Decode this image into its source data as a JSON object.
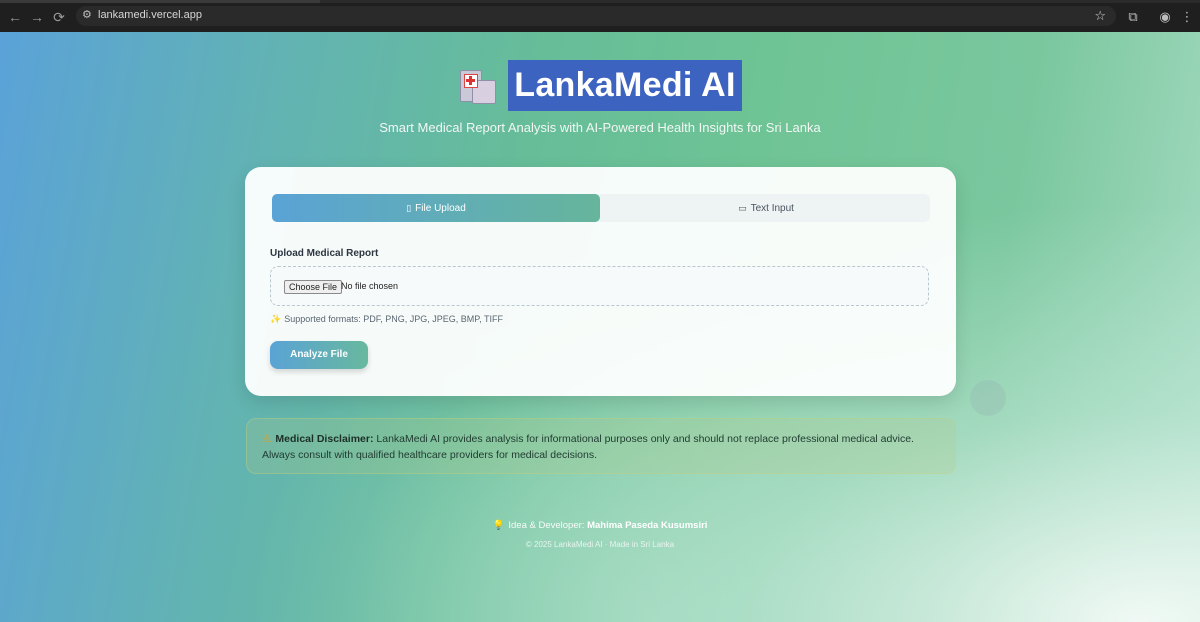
{
  "browser": {
    "url": "lankamedi.vercel.app",
    "back_icon": "←",
    "forward_icon": "→",
    "reload_icon": "⟳",
    "star_icon": "☆"
  },
  "header": {
    "title": "LankaMedi AI",
    "subtitle": "Smart Medical Report Analysis with AI-Powered Health Insights for Sri Lanka"
  },
  "tabs": [
    {
      "icon": "▯",
      "label": "File Upload",
      "active": true
    },
    {
      "icon": "▭",
      "label": "Text Input",
      "active": false
    }
  ],
  "upload": {
    "label": "Upload Medical Report",
    "choose_button": "Choose File",
    "status": "No file chosen",
    "formats": "Supported formats: PDF, PNG, JPG, JPEG, BMP, TIFF",
    "analyze_button": "Analyze File"
  },
  "disclaimer": {
    "heading": "Medical Disclaimer:",
    "text": "LankaMedi AI provides analysis for informational purposes only and should not replace professional medical advice.",
    "text2": "Always consult with qualified healthcare providers for medical decisions."
  },
  "footer": {
    "credit_label": "Idea & Developer:",
    "credit_name": "Mahima Paseda Kusumsiri",
    "copyright": "© 2025 LankaMedi AI · Made in Sri Lanka"
  },
  "colors": {
    "accent_blue": "#5aa3d6",
    "accent_green": "#66b59b",
    "title_highlight": "#3d63c1"
  }
}
